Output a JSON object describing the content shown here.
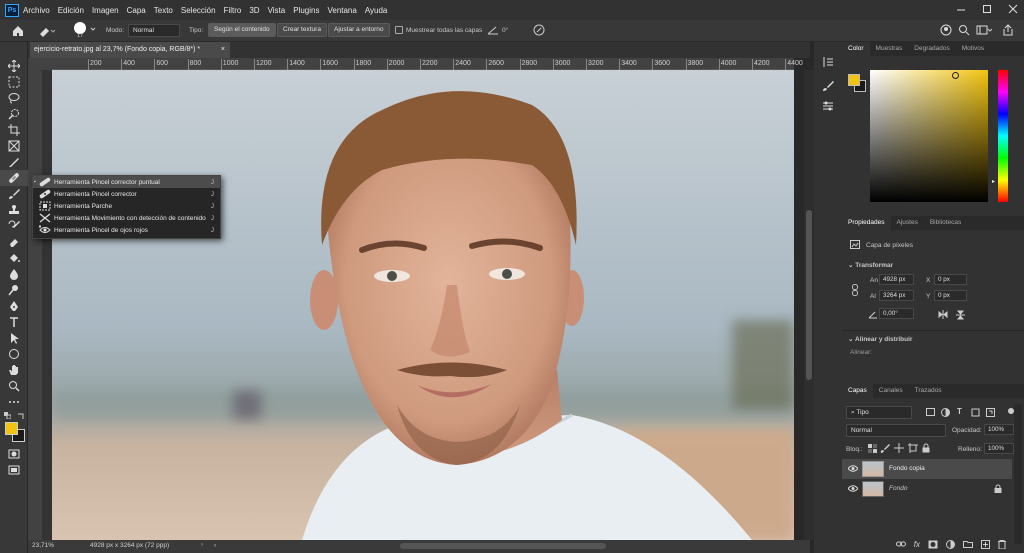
{
  "app": {
    "name": "Ps",
    "menu": [
      "Archivo",
      "Edición",
      "Imagen",
      "Capa",
      "Texto",
      "Selección",
      "Filtro",
      "3D",
      "Vista",
      "Plugins",
      "Ventana",
      "Ayuda"
    ]
  },
  "options": {
    "size": "17",
    "mode_label": "Modo:",
    "mode_value": "Normal",
    "type_label": "Tipo:",
    "btn_content": "Según el contenido",
    "btn_texture": "Crear textura",
    "btn_around": "Ajustar a entorno",
    "sample_all": "Muestrear todas las capas",
    "angle": "0°"
  },
  "doc": {
    "tab_title": "ejercicio-retrato.jpg al 23,7% (Fondo copia, RGB/8*) *",
    "zoom": "23,71%",
    "info": "4928 px x 3264 px (72 ppp)",
    "ruler": [
      "200",
      "400",
      "600",
      "800",
      "1000",
      "1200",
      "1400",
      "1600",
      "1800",
      "2000",
      "2200",
      "2400",
      "2600",
      "2800",
      "3000",
      "3200",
      "3400",
      "3600",
      "3800",
      "4000",
      "4200",
      "4400"
    ]
  },
  "flyout": {
    "items": [
      {
        "label": "Herramienta Pincel corrector puntual",
        "key": "J",
        "icon": "spot-healing-brush-icon",
        "active": true
      },
      {
        "label": "Herramienta Pincel corrector",
        "key": "J",
        "icon": "healing-brush-icon",
        "active": false
      },
      {
        "label": "Herramienta Parche",
        "key": "J",
        "icon": "patch-icon",
        "active": false
      },
      {
        "label": "Herramienta Movimiento con detección de contenido",
        "key": "J",
        "icon": "content-aware-move-icon",
        "active": false
      },
      {
        "label": "Herramienta Pincel de ojos rojos",
        "key": "J",
        "icon": "red-eye-icon",
        "active": false
      }
    ]
  },
  "color_panel": {
    "tabs": [
      "Color",
      "Muestras",
      "Degradados",
      "Motivos"
    ],
    "fg": "#f2c40f",
    "bg": "#1a1a1a"
  },
  "properties": {
    "tabs": [
      "Propiedades",
      "Ajustes",
      "Bibliotecas"
    ],
    "layer_type": "Capa de píxeles",
    "transform_title": "Transformar",
    "an_label": "An",
    "an": "4928 px",
    "x_label": "X",
    "x": "0 px",
    "al_label": "Al",
    "al": "3264 px",
    "y_label": "Y",
    "y": "0 px",
    "angle": "0,00°",
    "align_title": "Alinear y distribuir",
    "align_label": "Alinear:"
  },
  "layers": {
    "tabs": [
      "Capas",
      "Canales",
      "Trazados"
    ],
    "filter": "Tipo",
    "blend": "Normal",
    "opacity_label": "Opacidad:",
    "opacity": "100%",
    "lock_label": "Bloq.:",
    "fill_label": "Relleno:",
    "fill": "100%",
    "items": [
      {
        "name": "Fondo copia",
        "selected": true,
        "locked": false
      },
      {
        "name": "Fondo",
        "selected": false,
        "locked": true
      }
    ]
  }
}
